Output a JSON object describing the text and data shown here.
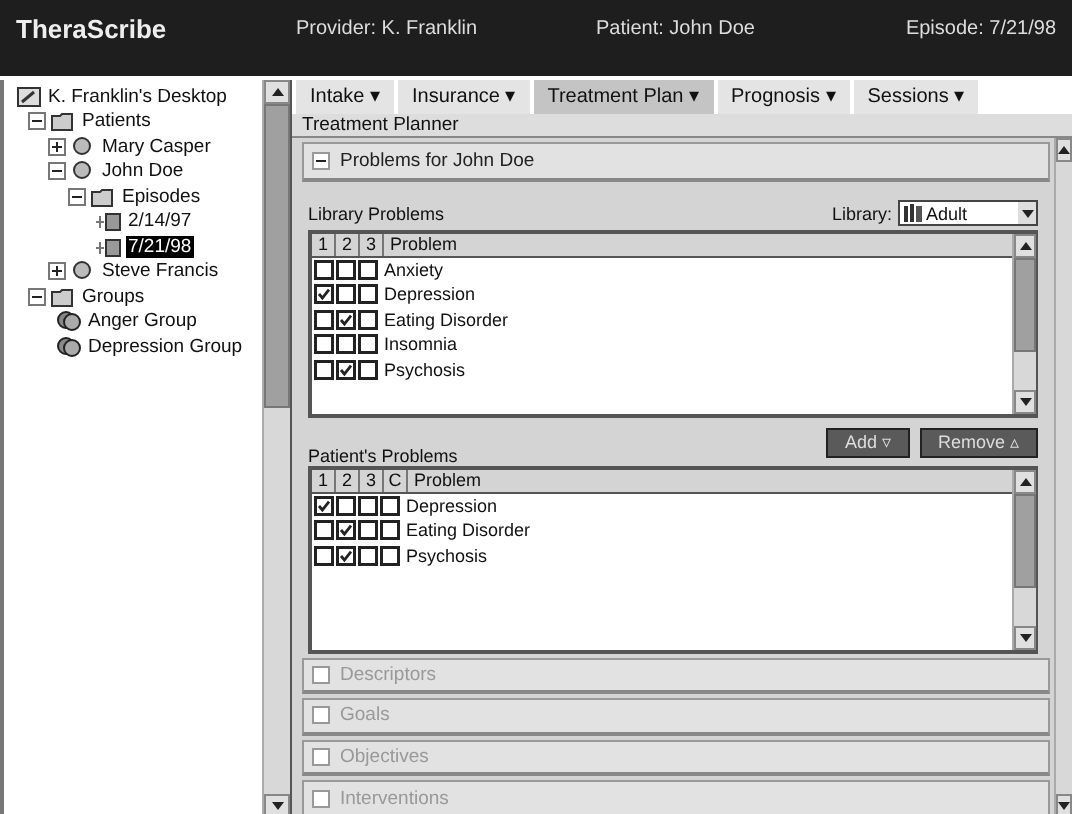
{
  "header": {
    "app_name": "TheraScribe",
    "provider": "Provider: K. Franklin",
    "patient": "Patient: John Doe",
    "episode": "Episode: 7/21/98"
  },
  "tree": [
    {
      "label": "K. Franklin's Desktop",
      "kind": "desktop",
      "selected": false,
      "children": [
        {
          "label": "Patients",
          "kind": "folder",
          "expanded": true,
          "selected": false,
          "children": [
            {
              "label": "Mary Casper",
              "kind": "person",
              "expanded": false,
              "selected": false
            },
            {
              "label": "John Doe",
              "kind": "person",
              "expanded": true,
              "selected": false,
              "children": [
                {
                  "label": "Episodes",
                  "kind": "folder",
                  "expanded": true,
                  "selected": false,
                  "children": [
                    {
                      "label": "2/14/97",
                      "kind": "episode",
                      "selected": false
                    },
                    {
                      "label": "7/21/98",
                      "kind": "episode",
                      "selected": true
                    }
                  ]
                }
              ]
            },
            {
              "label": "Steve Francis",
              "kind": "person",
              "expanded": false,
              "selected": false
            }
          ]
        },
        {
          "label": "Groups",
          "kind": "folder",
          "expanded": true,
          "selected": false,
          "children": [
            {
              "label": "Anger Group",
              "kind": "group",
              "selected": false
            },
            {
              "label": "Depression Group",
              "kind": "group",
              "selected": false
            }
          ]
        }
      ]
    }
  ],
  "tabs": [
    {
      "label": "Intake ▾",
      "selected": false
    },
    {
      "label": "Insurance ▾",
      "selected": false
    },
    {
      "label": "Treatment Plan ▾",
      "selected": true
    },
    {
      "label": "Prognosis ▾",
      "selected": false
    },
    {
      "label": "Sessions ▾",
      "selected": false
    }
  ],
  "page_title": "Treatment Planner",
  "problems_section": {
    "title": "Problems for John Doe",
    "expanded": true,
    "library_label": "Library Problems",
    "library_select_label": "Library:",
    "library_value": "Adult",
    "library_table": {
      "columns": [
        "1",
        "2",
        "3",
        "Problem"
      ],
      "rows": [
        {
          "checks": [
            false,
            false,
            false
          ],
          "problem": "Anxiety"
        },
        {
          "checks": [
            true,
            false,
            false
          ],
          "problem": "Depression"
        },
        {
          "checks": [
            false,
            true,
            false
          ],
          "problem": "Eating Disorder"
        },
        {
          "checks": [
            false,
            false,
            false
          ],
          "problem": "Insomnia"
        },
        {
          "checks": [
            false,
            true,
            false
          ],
          "problem": "Psychosis"
        }
      ]
    },
    "add_button": "Add ▿",
    "remove_button": "Remove ▵",
    "patient_label": "Patient's Problems",
    "patient_table": {
      "columns": [
        "1",
        "2",
        "3",
        "C",
        "Problem"
      ],
      "rows": [
        {
          "checks": [
            true,
            false,
            false,
            false
          ],
          "problem": "Depression"
        },
        {
          "checks": [
            false,
            true,
            false,
            false
          ],
          "problem": "Eating Disorder"
        },
        {
          "checks": [
            false,
            true,
            false,
            false
          ],
          "problem": "Psychosis"
        }
      ]
    }
  },
  "sections": [
    {
      "title": "Descriptors",
      "expanded": false
    },
    {
      "title": "Goals",
      "expanded": false
    },
    {
      "title": "Objectives",
      "expanded": false
    },
    {
      "title": "Interventions",
      "expanded": false
    }
  ]
}
